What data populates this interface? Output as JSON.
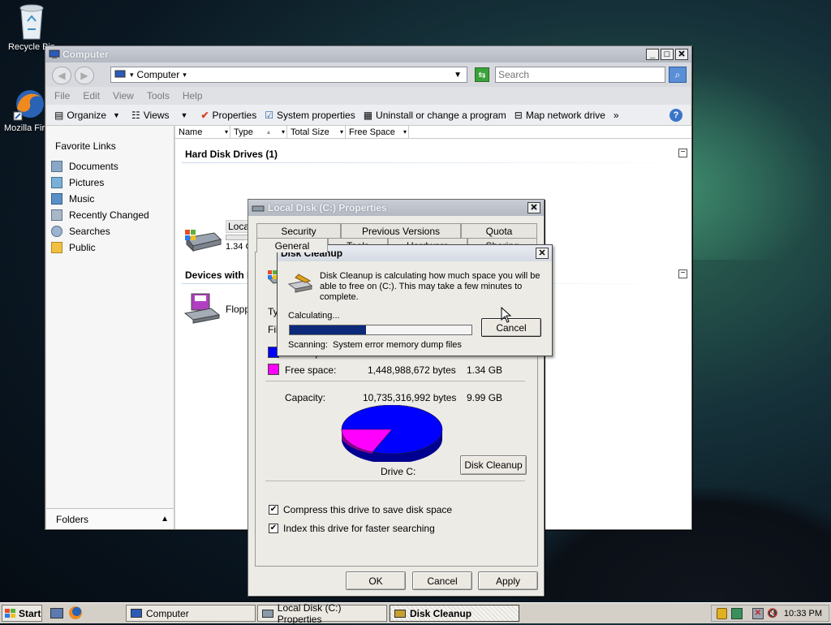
{
  "desktop": {
    "icons": [
      {
        "label": "Recycle Bin",
        "icon": "recycle-bin-icon"
      },
      {
        "label": "Mozilla Firefox",
        "icon": "firefox-icon"
      }
    ]
  },
  "explorer": {
    "title": "Computer",
    "address": "Computer",
    "search_placeholder": "Search",
    "menu": [
      "File",
      "Edit",
      "View",
      "Tools",
      "Help"
    ],
    "commands": [
      "Organize",
      "Views",
      "Properties",
      "System properties",
      "Uninstall or change a program",
      "Map network drive",
      "»"
    ],
    "favorite_links_heading": "Favorite Links",
    "favorite_links": [
      "Documents",
      "Pictures",
      "Music",
      "Recently Changed",
      "Searches",
      "Public"
    ],
    "folders_label": "Folders",
    "columns": [
      "Name",
      "Type",
      "Total Size",
      "Free Space"
    ],
    "groups": {
      "hard_disks": "Hard Disk Drives (1)",
      "removable": "Devices with Removable Storage (1)"
    },
    "drive_name": "Local Disk (C:)",
    "drive_free_text": "1.34 GB free of 9.99 GB",
    "floppy_name": "Floppy Disk Drive (A:)"
  },
  "properties": {
    "title": "Local Disk (C:) Properties",
    "tabs_row1": [
      "Security",
      "Previous Versions",
      "Quota"
    ],
    "tabs_row2": [
      "General",
      "Tools",
      "Hardware",
      "Sharing"
    ],
    "type_label": "Type:",
    "fs_label": "File system:",
    "used_space_label": "Used space:",
    "free_space_label": "Free space:",
    "free_space_bytes": "1,448,988,672 bytes",
    "free_space_gb": "1.34 GB",
    "capacity_label": "Capacity:",
    "capacity_bytes": "10,735,316,992 bytes",
    "capacity_gb": "9.99 GB",
    "drive_caption": "Drive C:",
    "disk_cleanup_button": "Disk Cleanup",
    "compress_label": "Compress this drive to save disk space",
    "index_label": "Index this drive for faster searching",
    "compress_checked": true,
    "index_checked": true,
    "ok": "OK",
    "cancel": "Cancel",
    "apply": "Apply",
    "used_fraction": 0.865,
    "used_color": "#0000ff",
    "free_color": "#ff00ff"
  },
  "cleanup": {
    "title": "Disk Cleanup",
    "message": "Disk Cleanup is calculating how much space you will be able to free on  (C:). This may take a few minutes to complete.",
    "status": "Calculating...",
    "progress_percent": 42,
    "scanning_label": "Scanning:",
    "scanning_item": "System error memory dump files",
    "cancel": "Cancel"
  },
  "taskbar": {
    "start": "Start",
    "tasks": [
      "Computer",
      "Local Disk (C:) Properties",
      "Disk Cleanup"
    ],
    "clock": "10:33 PM"
  }
}
